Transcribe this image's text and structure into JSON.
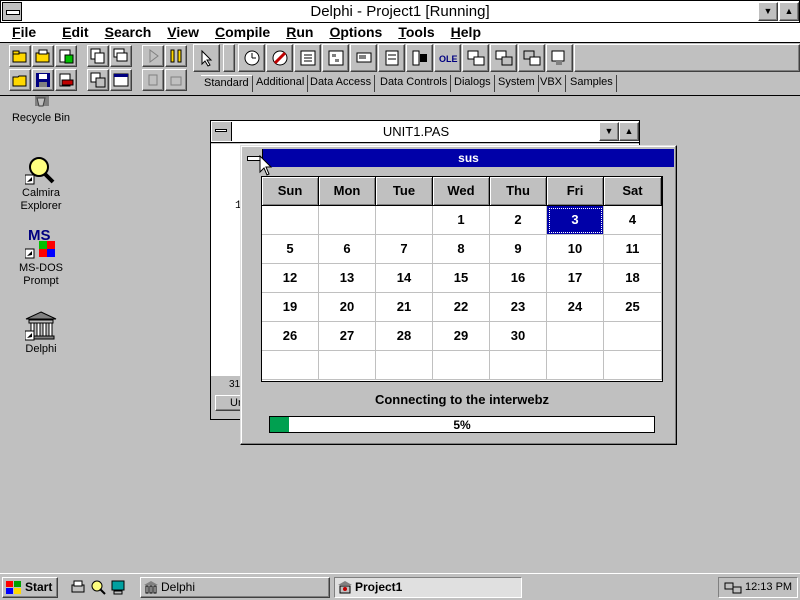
{
  "delphi": {
    "title": "Delphi - Project1 [Running]",
    "menu": [
      "File",
      "Edit",
      "Search",
      "View",
      "Compile",
      "Run",
      "Options",
      "Tools",
      "Help"
    ],
    "palette_tabs": [
      "Standard",
      "Additional",
      "Data Access",
      "Data Controls",
      "Dialogs",
      "System",
      "VBX",
      "Samples"
    ]
  },
  "desktop": {
    "icons": [
      {
        "label": "Recycle Bin"
      },
      {
        "label": "Calmira Explorer"
      },
      {
        "label": "MS-DOS Prompt"
      },
      {
        "label": "Delphi"
      }
    ]
  },
  "unit": {
    "title": "UNIT1.PAS",
    "line_number": "1",
    "status": "31",
    "tab": "Ur"
  },
  "form": {
    "title": "sus",
    "weekdays": [
      "Sun",
      "Mon",
      "Tue",
      "Wed",
      "Thu",
      "Fri",
      "Sat"
    ],
    "weeks": [
      [
        "",
        "",
        "",
        "1",
        "2",
        "3",
        "4"
      ],
      [
        "5",
        "6",
        "7",
        "8",
        "9",
        "10",
        "11"
      ],
      [
        "12",
        "13",
        "14",
        "15",
        "16",
        "17",
        "18"
      ],
      [
        "19",
        "20",
        "21",
        "22",
        "23",
        "24",
        "25"
      ],
      [
        "26",
        "27",
        "28",
        "29",
        "30",
        "",
        ""
      ],
      [
        "",
        "",
        "",
        "",
        "",
        "",
        ""
      ]
    ],
    "selected_day": "3",
    "status": "Connecting to the interwebz",
    "progress": 5,
    "progress_label": "5%"
  },
  "taskbar": {
    "start": "Start",
    "tasks": [
      "Delphi",
      "Project1"
    ],
    "clock": "12:13 PM"
  },
  "colors": {
    "caption_active": "#0000a8",
    "progress_fill": "#00a050",
    "desktop": "#c0c0c0"
  }
}
